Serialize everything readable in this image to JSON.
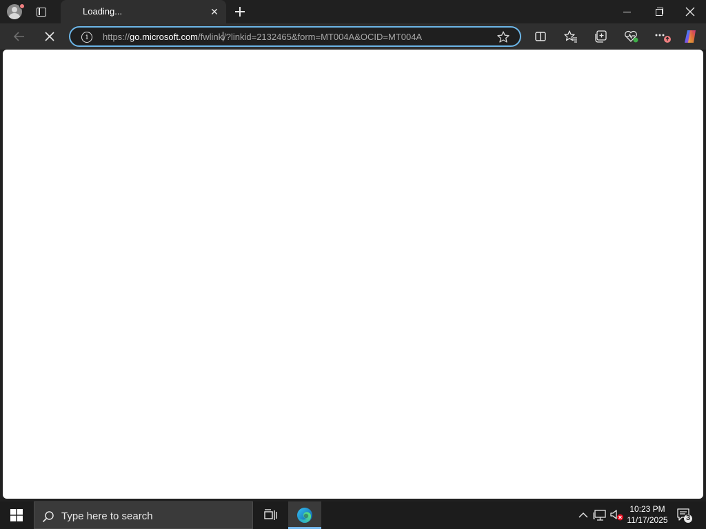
{
  "tab": {
    "title": "Loading...",
    "close_glyph": "✕"
  },
  "window": {
    "close_glyph": "✕"
  },
  "address_bar": {
    "scheme": "https://",
    "host": "go.microsoft.com",
    "path_before_caret": "/fwlink",
    "path_after_caret": "/?linkid=2132465&form=MT004A&OCID=MT004A"
  },
  "taskbar": {
    "search_placeholder": "Type here to search",
    "time": "10:23 PM",
    "date": "11/17/2025",
    "notification_count": "3"
  },
  "colors": {
    "address_border": "#6cb6e8",
    "content_bg": "#ffffff",
    "edge_active_underline": "#76b9ed"
  },
  "icons": {
    "profile": "profile-avatar-icon",
    "tab_actions": "tab-actions-icon",
    "new_tab": "plus-icon",
    "back": "arrow-left-icon",
    "stop": "close-icon",
    "info": "info-icon",
    "favorite": "star-icon",
    "split_screen": "split-screen-icon",
    "favorites": "favorites-icon",
    "collections": "collections-icon",
    "browser_essentials": "heart-pulse-icon",
    "more": "ellipsis-icon",
    "copilot": "copilot-icon",
    "start": "windows-logo-icon",
    "search": "search-icon",
    "task_view": "task-view-icon",
    "edge": "edge-icon",
    "tray_chevron": "chevron-up-icon",
    "network": "network-icon",
    "volume": "volume-muted-icon",
    "notifications": "notifications-icon"
  }
}
